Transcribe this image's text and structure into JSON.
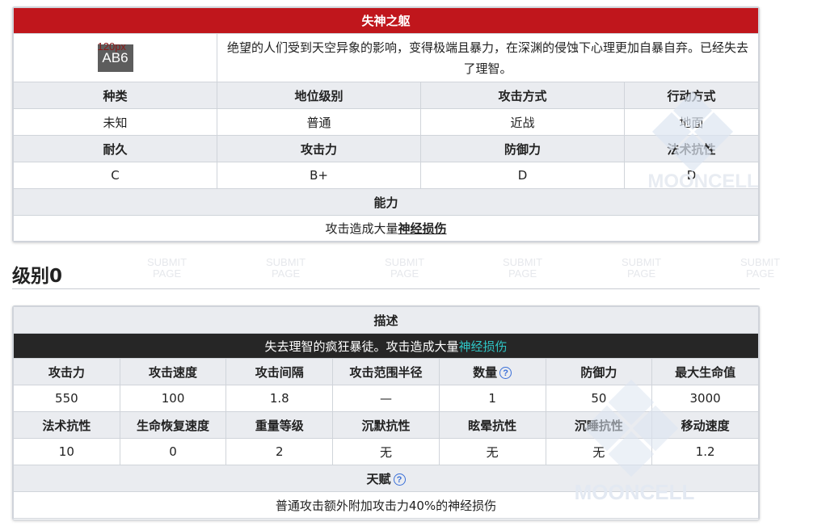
{
  "monster_card": {
    "title": "失神之躯",
    "image_placeholder": "AB6",
    "image_size_text": "120px",
    "description": "绝望的人们受到天空异象的影响，变得极端且暴力，在深渊的侵蚀下心理更加自暴自弃。已经失去了理智。",
    "row1_headers": [
      "种类",
      "地位级别",
      "攻击方式",
      "行动方式"
    ],
    "row1_values": [
      "未知",
      "普通",
      "近战",
      "地面"
    ],
    "row2_headers": [
      "耐久",
      "攻击力",
      "防御力",
      "法术抗性"
    ],
    "row2_values": [
      "C",
      "B+",
      "D",
      "D"
    ],
    "ability_header": "能力",
    "ability_prefix": "攻击造成大量",
    "ability_link": "神经损伤"
  },
  "level_section": {
    "title": "级别0"
  },
  "level_card": {
    "desc_header": "描述",
    "desc_prefix": "失去理智的疯狂暴徒。攻击造成大量",
    "desc_highlight": "神经损伤",
    "stats1_headers": [
      "攻击力",
      "攻击速度",
      "攻击间隔",
      "攻击范围半径",
      "数量",
      "防御力",
      "最大生命值"
    ],
    "stats1_values": [
      "550",
      "100",
      "1.8",
      "—",
      "1",
      "50",
      "3000"
    ],
    "stats2_headers": [
      "法术抗性",
      "生命恢复速度",
      "重量等级",
      "沉默抗性",
      "眩晕抗性",
      "沉睡抗性",
      "移动速度"
    ],
    "stats2_values": [
      "10",
      "0",
      "2",
      "无",
      "无",
      "无",
      "1.2"
    ],
    "talent_header": "天赋",
    "talent_text": "普通攻击额外附加攻击力40%的神经损伤",
    "help_glyph": "?"
  },
  "watermark": {
    "submit_line1": "SUBMIT",
    "submit_line2": "PAGE",
    "brand": "MOONCELL"
  },
  "colors": {
    "title_red": "#c0161c",
    "header_gray": "#eaecf0",
    "desc_dark": "#262626",
    "highlight_cyan": "#2ec4c4",
    "help_blue": "#3a6fd8"
  }
}
